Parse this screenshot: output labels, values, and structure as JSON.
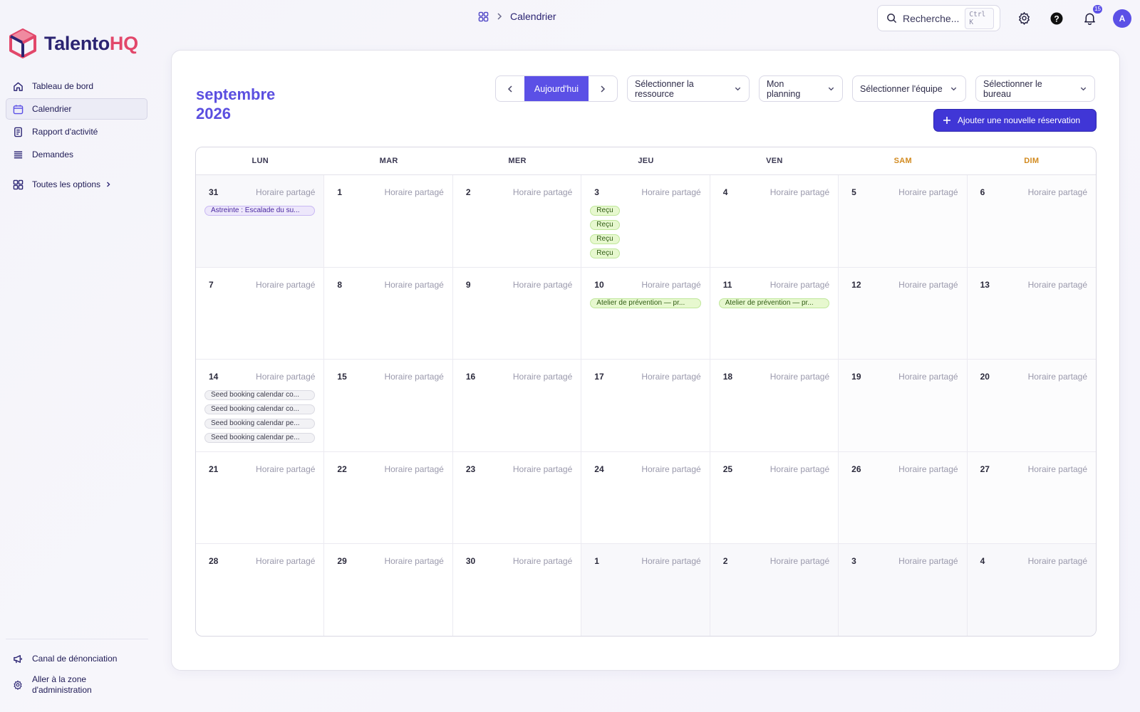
{
  "app": {
    "brand_a": "Talento",
    "brand_b": "HQ",
    "colors": {
      "accent": "#5b50e6",
      "brand_pink": "#e2476a",
      "brand_navy": "#2b2472",
      "weekend_header": "#d28a1f"
    }
  },
  "sidebar": {
    "items": [
      {
        "label": "Tableau de bord",
        "icon": "home-icon"
      },
      {
        "label": "Calendrier",
        "icon": "calendar-icon"
      },
      {
        "label": "Rapport d'activité",
        "icon": "report-icon"
      },
      {
        "label": "Demandes",
        "icon": "list-icon"
      }
    ],
    "options_label": "Toutes les options",
    "footer": [
      {
        "label": "Canal de dénonciation",
        "icon": "megaphone-icon"
      },
      {
        "label": "Aller à la zone d'administration",
        "icon": "gear-icon"
      }
    ]
  },
  "topbar": {
    "breadcrumb": "Calendrier",
    "search_placeholder": "Recherche...",
    "search_shortcut": "Ctrl K",
    "notifications": "15",
    "avatar_initial": "A"
  },
  "calendar": {
    "month": "septembre",
    "year": "2026",
    "today_label": "Aujourd'hui",
    "filters": [
      "Sélectionner la ressource",
      "Mon planning",
      "Sélectionner l'équipe",
      "Sélectionner le bureau"
    ],
    "add_label": "Ajouter une nouvelle réservation",
    "weekdays": [
      "LUN",
      "MAR",
      "MER",
      "JEU",
      "VEN",
      "SAM",
      "DIM"
    ],
    "cell_caption": "Horaire partagé",
    "weeks": [
      [
        {
          "day": "31",
          "outside": true,
          "events": [
            {
              "label": "Astreinte : Escalade du su...",
              "color": "purple"
            }
          ]
        },
        {
          "day": "1",
          "events": []
        },
        {
          "day": "2",
          "events": []
        },
        {
          "day": "3",
          "events": [
            {
              "label": "Reçu",
              "color": "green"
            },
            {
              "label": "Reçu",
              "color": "green"
            },
            {
              "label": "Reçu",
              "color": "green"
            },
            {
              "label": "Reçu",
              "color": "green"
            }
          ]
        },
        {
          "day": "4",
          "events": []
        },
        {
          "day": "5",
          "events": []
        },
        {
          "day": "6",
          "events": []
        }
      ],
      [
        {
          "day": "7",
          "events": []
        },
        {
          "day": "8",
          "events": []
        },
        {
          "day": "9",
          "events": []
        },
        {
          "day": "10",
          "events": [
            {
              "label": "Atelier de prévention — pr...",
              "color": "green"
            }
          ]
        },
        {
          "day": "11",
          "events": [
            {
              "label": "Atelier de prévention — pr...",
              "color": "green"
            }
          ]
        },
        {
          "day": "12",
          "events": []
        },
        {
          "day": "13",
          "events": []
        }
      ],
      [
        {
          "day": "14",
          "events": [
            {
              "label": "Seed booking calendar co...",
              "color": "gray"
            },
            {
              "label": "Seed booking calendar co...",
              "color": "gray"
            },
            {
              "label": "Seed booking calendar pe...",
              "color": "gray"
            },
            {
              "label": "Seed booking calendar pe...",
              "color": "gray"
            }
          ]
        },
        {
          "day": "15",
          "events": []
        },
        {
          "day": "16",
          "events": []
        },
        {
          "day": "17",
          "events": []
        },
        {
          "day": "18",
          "events": []
        },
        {
          "day": "19",
          "events": []
        },
        {
          "day": "20",
          "events": []
        }
      ],
      [
        {
          "day": "21",
          "events": []
        },
        {
          "day": "22",
          "events": []
        },
        {
          "day": "23",
          "events": []
        },
        {
          "day": "24",
          "events": []
        },
        {
          "day": "25",
          "events": []
        },
        {
          "day": "26",
          "events": []
        },
        {
          "day": "27",
          "events": []
        }
      ],
      [
        {
          "day": "28",
          "events": []
        },
        {
          "day": "29",
          "events": []
        },
        {
          "day": "30",
          "events": []
        },
        {
          "day": "1",
          "outside": true,
          "events": []
        },
        {
          "day": "2",
          "outside": true,
          "events": []
        },
        {
          "day": "3",
          "outside": true,
          "events": []
        },
        {
          "day": "4",
          "outside": true,
          "events": []
        }
      ]
    ]
  }
}
